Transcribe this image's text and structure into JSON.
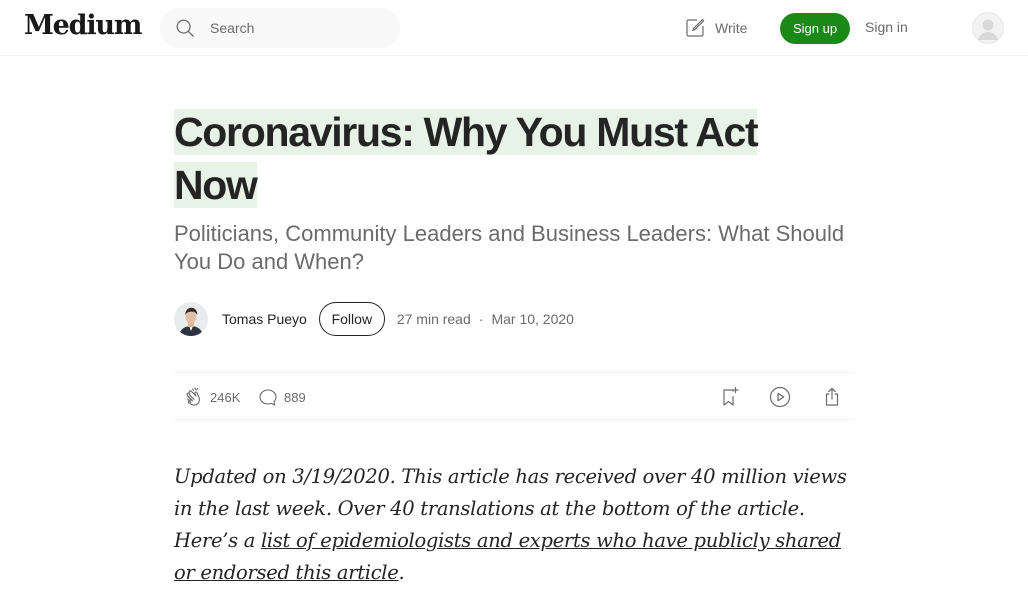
{
  "header": {
    "logo": "Medium",
    "search_placeholder": "Search",
    "write_label": "Write",
    "signup_label": "Sign up",
    "signin_label": "Sign in"
  },
  "article": {
    "title_line1": "Coronavirus: Why You Must Act",
    "title_line2": "Now",
    "subtitle": "Politicians, Community Leaders and Business Leaders: What Should You Do and When?",
    "author": "Tomas Pueyo",
    "follow_label": "Follow",
    "read_time": "27 min read",
    "separator": "·",
    "date": "Mar 10, 2020",
    "claps": "246K",
    "responses": "889",
    "body_intro": "Updated on 3/19/2020. This article has received over 40 million views in the last week. Over 40 translations at the bottom of the article. Here’s a ",
    "body_link": "list of epidemiologists and experts who have publicly shared or endorsed this article",
    "body_end": "."
  },
  "colors": {
    "accent_green": "#1a8917",
    "title_highlight": "#e8f3e8",
    "muted_text": "#6b6b6b",
    "text": "#242424"
  },
  "icons": [
    "search-icon",
    "write-icon",
    "user-avatar",
    "clap-icon",
    "response-icon",
    "bookmark-icon",
    "play-icon",
    "share-icon"
  ]
}
